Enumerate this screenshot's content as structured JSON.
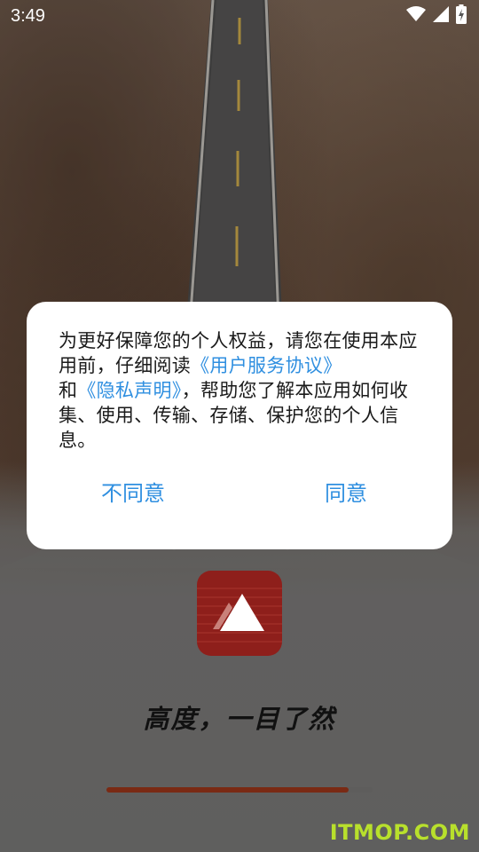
{
  "status_bar": {
    "time": "3:49",
    "icons": [
      "wifi-icon",
      "cellular-signal-icon",
      "battery-charging-icon"
    ]
  },
  "dialog": {
    "text_part1": "为更好保障您的个人权益，请您在使用本应用前，仔细阅读",
    "link_agreement": "《用户服务协议》",
    "text_part2": "和",
    "link_privacy": "《隐私声明》",
    "text_part3": "，帮助您了解本应用如何收集、使用、传输、存储、保护您的个人信息。",
    "disagree_label": "不同意",
    "agree_label": "同意"
  },
  "splash": {
    "logo_icon": "triangle-logo-icon",
    "slogan": "高度，一目了然",
    "loading_progress": 0.91
  },
  "watermark": "ITMOP.COM",
  "colors": {
    "accent_link": "#2f8fe0",
    "logo_bg": "#8e1f1b",
    "progress": "#7a2a14",
    "watermark": "#b8e02c"
  }
}
